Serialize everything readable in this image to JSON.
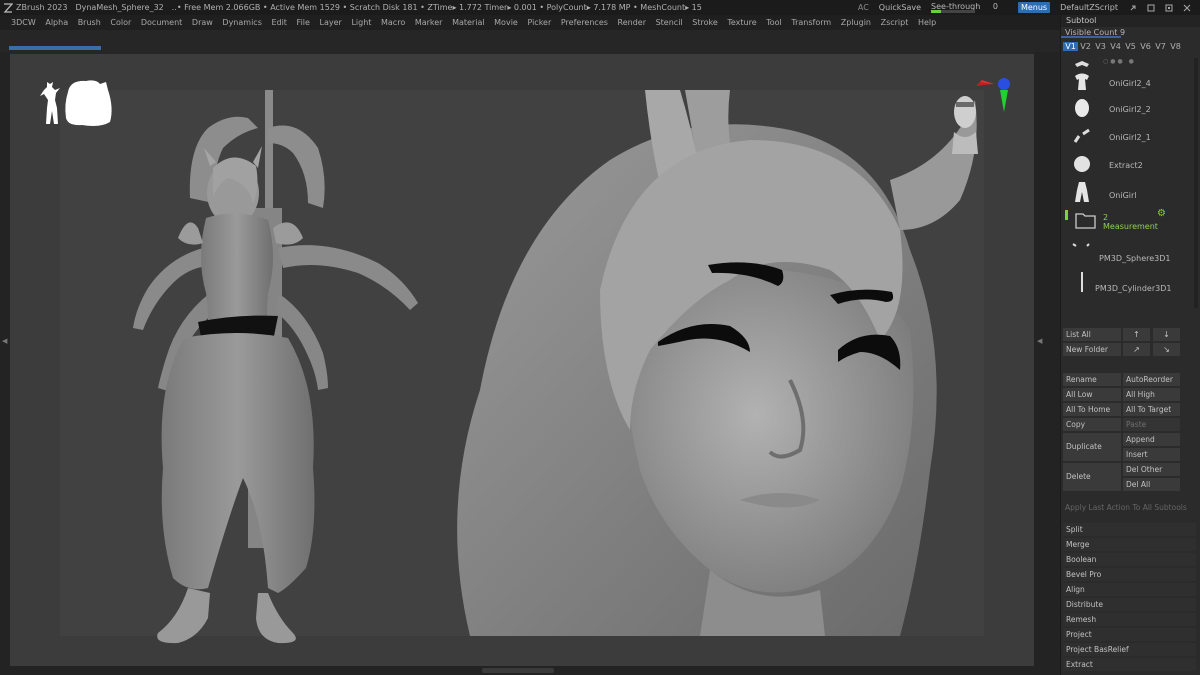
{
  "titlebar": {
    "app": "ZBrush 2023",
    "document": "DynaMesh_Sphere_32",
    "stats": "..• Free Mem 2.066GB • Active Mem 1529 • Scratch Disk 181 • ZTime▸ 1.772 Timer▸ 0.001 • PolyCount▸ 7.178 MP • MeshCount▸ 15",
    "ac": "AC",
    "quicksave": "QuickSave",
    "see_through_label": "See-through",
    "see_through_value": "0",
    "menus": "Menus",
    "script": "DefaultZScript"
  },
  "menubar": [
    "3DCW",
    "Alpha",
    "Brush",
    "Color",
    "Document",
    "Draw",
    "Dynamics",
    "Edit",
    "File",
    "Layer",
    "Light",
    "Macro",
    "Marker",
    "Material",
    "Movie",
    "Picker",
    "Preferences",
    "Render",
    "Stencil",
    "Stroke",
    "Texture",
    "Tool",
    "Transform",
    "Zplugin",
    "Zscript",
    "Help"
  ],
  "subtool": {
    "header": "Subtool",
    "visible_count": "Visible Count 9",
    "version_tabs": [
      "V1",
      "V2",
      "V3",
      "V4",
      "V5",
      "V6",
      "V7",
      "V8"
    ],
    "selected_version": "V1",
    "items": [
      {
        "name": ""
      },
      {
        "name": "OniGirl2_4"
      },
      {
        "name": "OniGirl2_2"
      },
      {
        "name": "OniGirl2_1"
      },
      {
        "name": "Extract2"
      },
      {
        "name": "OniGirl"
      },
      {
        "name": "2 Measurement",
        "count": "2",
        "label": "Measurement"
      },
      {
        "name": "PM3D_Sphere3D1"
      },
      {
        "name": "PM3D_Cylinder3D1"
      }
    ],
    "buttons": {
      "list_all": "List All",
      "new_folder": "New Folder",
      "rename": "Rename",
      "auto_reorder": "AutoReorder",
      "all_low": "All Low",
      "all_high": "All High",
      "all_to_home": "All To Home",
      "all_to_target": "All To Target",
      "copy": "Copy",
      "paste": "Paste",
      "duplicate": "Duplicate",
      "append": "Append",
      "insert": "Insert",
      "delete": "Delete",
      "del_other": "Del Other",
      "del_all": "Del All",
      "apply_last": "Apply Last Action To All Subtools"
    },
    "sections": [
      "Split",
      "Merge",
      "Boolean",
      "Bevel Pro",
      "Align",
      "Distribute",
      "Remesh",
      "Project",
      "Project BasRelief",
      "Extract"
    ]
  },
  "icons": {
    "logo": "zbrush-logo-icon",
    "gizmo": "xyz-axis-gizmo-icon",
    "head": "head-navigation-icon"
  },
  "colors": {
    "accent": "#2f6db3",
    "green": "#7fd33a",
    "canvas": "#414141",
    "model": "#8c8c8c"
  }
}
